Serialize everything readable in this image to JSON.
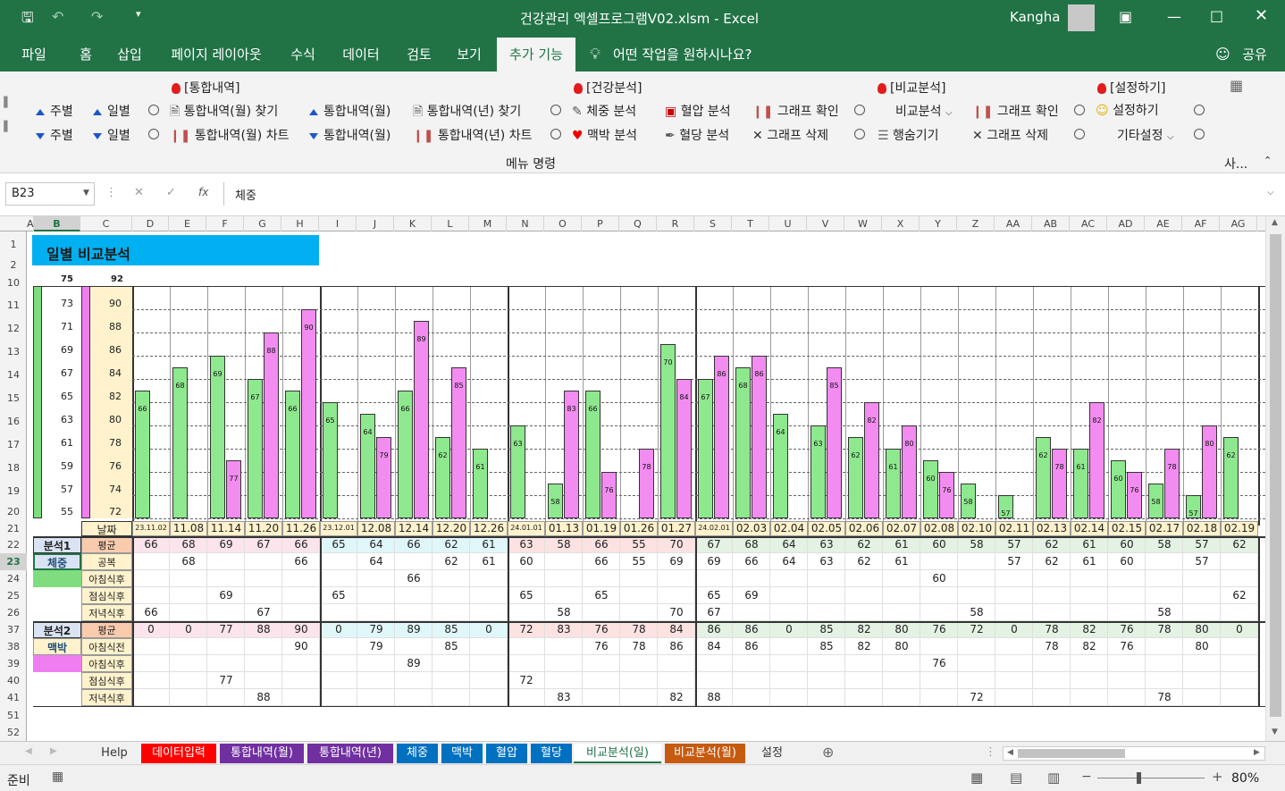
{
  "window": {
    "title": "건강관리 엑셀프로그램V02.xlsm  -  Excel",
    "user": "Kangha"
  },
  "tabs": [
    "파일",
    "홈",
    "삽입",
    "페이지 레이아웃",
    "수식",
    "데이터",
    "검토",
    "보기",
    "추가 기능"
  ],
  "tell_me": "어떤 작업을 원하시나요?",
  "share": "공유",
  "ribbon": {
    "group_headers": [
      "[통합내역]",
      "[건강분석]",
      "[비교분석]",
      "[설정하기]"
    ],
    "row1": [
      "주별",
      "일별",
      "통합내역(월) 찾기",
      "통합내역(월)",
      "통합내역(년) 찾기",
      "체중 분석",
      "혈압 분석",
      "그래프 확인",
      "비교분석",
      "그래프 확인",
      "설정하기"
    ],
    "row2": [
      "주별",
      "일별",
      "통합내역(월) 차트",
      "통합내역(월)",
      "통합내역(년) 차트",
      "맥박 분석",
      "혈당 분석",
      "그래프 삭제",
      "행숨기기",
      "그래프 삭제",
      "기타설정"
    ],
    "group_label": "메뉴 명령",
    "cut_label": "사..."
  },
  "formula_bar": {
    "name_box": "B23",
    "content": "체중",
    "fx": "fx"
  },
  "col_headers": [
    "A",
    "B",
    "C",
    "D",
    "E",
    "F",
    "G",
    "H",
    "I",
    "J",
    "K",
    "L",
    "M",
    "N",
    "O",
    "P",
    "Q",
    "R",
    "S",
    "T",
    "U",
    "V",
    "W",
    "X",
    "Y",
    "Z",
    "AA",
    "AB",
    "AC",
    "AD",
    "AE",
    "AF",
    "AG"
  ],
  "row_headers": [
    "1",
    "2",
    "10",
    "11",
    "12",
    "13",
    "14",
    "15",
    "16",
    "17",
    "18",
    "19",
    "20",
    "21",
    "22",
    "23",
    "24",
    "25",
    "26",
    "37",
    "38",
    "39",
    "40",
    "41",
    "51",
    "52"
  ],
  "sheet": {
    "title": "일별 비교분석",
    "scale_left_top": "75",
    "scale_right_top": "92",
    "scale_left": [
      "73",
      "71",
      "69",
      "67",
      "65",
      "63",
      "61",
      "59",
      "57",
      "55"
    ],
    "scale_right": [
      "90",
      "88",
      "86",
      "84",
      "82",
      "80",
      "78",
      "76",
      "74",
      "72"
    ],
    "date_header": "날짜",
    "dates": [
      "23.11.02",
      "11.08",
      "11.14",
      "11.20",
      "11.26",
      "23.12.01",
      "12.08",
      "12.14",
      "12.20",
      "12.26",
      "24.01.01",
      "01.13",
      "01.19",
      "01.26",
      "01.27",
      "24.02.01",
      "02.03",
      "02.04",
      "02.05",
      "02.06",
      "02.07",
      "02.08",
      "02.10",
      "02.11",
      "02.13",
      "02.14",
      "02.15",
      "02.17",
      "02.18",
      "02.19"
    ],
    "analysis1_label": "분석1",
    "analysis1_item": "체중",
    "analysis2_label": "분석2",
    "analysis2_item": "맥박",
    "row_labels1": [
      "평균",
      "공복",
      "아침식후",
      "점심식후",
      "저녁식후"
    ],
    "row_labels2": [
      "평균",
      "아침식전",
      "아침식후",
      "점심식후",
      "저녁식후"
    ],
    "a1_rows": [
      [
        "66",
        "68",
        "69",
        "67",
        "66",
        "65",
        "64",
        "66",
        "62",
        "61",
        "63",
        "58",
        "66",
        "55",
        "70",
        "67",
        "68",
        "64",
        "63",
        "62",
        "61",
        "60",
        "58",
        "57",
        "62",
        "61",
        "60",
        "58",
        "57",
        "62"
      ],
      [
        "",
        "68",
        "",
        "",
        "66",
        "",
        "64",
        "",
        "62",
        "61",
        "60",
        "",
        "66",
        "55",
        "69",
        "69",
        "66",
        "64",
        "63",
        "62",
        "61",
        "",
        "",
        "57",
        "62",
        "61",
        "60",
        "",
        "57",
        ""
      ],
      [
        "",
        "",
        "",
        "",
        "",
        "",
        "",
        "66",
        "",
        "",
        "",
        "",
        "",
        "",
        "",
        "",
        "",
        "",
        "",
        "",
        "",
        "60",
        "",
        "",
        "",
        "",
        "",
        "",
        "",
        ""
      ],
      [
        "",
        "",
        "69",
        "",
        "",
        "65",
        "",
        "",
        "",
        "",
        "65",
        "",
        "65",
        "",
        "",
        "65",
        "69",
        "",
        "",
        "",
        "",
        "",
        "",
        "",
        "",
        "",
        "",
        "",
        "",
        "62"
      ],
      [
        "66",
        "",
        "",
        "67",
        "",
        "",
        "",
        "",
        "",
        "",
        "",
        "58",
        "",
        "",
        "70",
        "67",
        "",
        "",
        "",
        "",
        "",
        "",
        "58",
        "",
        "",
        "",
        "",
        "58",
        "",
        ""
      ]
    ],
    "a2_rows": [
      [
        "0",
        "0",
        "77",
        "88",
        "90",
        "0",
        "79",
        "89",
        "85",
        "0",
        "72",
        "83",
        "76",
        "78",
        "84",
        "86",
        "86",
        "0",
        "85",
        "82",
        "80",
        "76",
        "72",
        "0",
        "78",
        "82",
        "76",
        "78",
        "80",
        "0"
      ],
      [
        "",
        "",
        "",
        "",
        "90",
        "",
        "79",
        "",
        "85",
        "",
        "",
        "",
        "76",
        "78",
        "86",
        "84",
        "86",
        "",
        "85",
        "82",
        "80",
        "",
        "",
        "",
        "78",
        "82",
        "76",
        "",
        "80",
        ""
      ],
      [
        "",
        "",
        "",
        "",
        "",
        "",
        "",
        "89",
        "",
        "",
        "",
        "",
        "",
        "",
        "",
        "",
        "",
        "",
        "",
        "",
        "",
        "76",
        "",
        "",
        "",
        "",
        "",
        "",
        "",
        ""
      ],
      [
        "",
        "",
        "77",
        "",
        "",
        "",
        "",
        "",
        "",
        "",
        "72",
        "",
        "",
        "",
        "",
        "",
        "",
        "",
        "",
        "",
        "",
        "",
        "",
        "",
        "",
        "",
        "",
        "",
        "",
        ""
      ],
      [
        "",
        "",
        "",
        "88",
        "",
        "",
        "",
        "",
        "",
        "",
        "",
        "83",
        "",
        "",
        "82",
        "88",
        "",
        "",
        "",
        "",
        "",
        "",
        "72",
        "",
        "",
        "",
        "",
        "78",
        "",
        ""
      ]
    ]
  },
  "chart_data": {
    "type": "bar",
    "categories": [
      "23.11.02",
      "11.08",
      "11.14",
      "11.20",
      "11.26",
      "23.12.01",
      "12.08",
      "12.14",
      "12.20",
      "12.26",
      "24.01.01",
      "01.13",
      "01.19",
      "01.26",
      "01.27",
      "24.02.01",
      "02.03",
      "02.04",
      "02.05",
      "02.06",
      "02.07",
      "02.08",
      "02.10",
      "02.11",
      "02.13",
      "02.14",
      "02.15",
      "02.17",
      "02.18",
      "02.19"
    ],
    "series": [
      {
        "name": "체중",
        "color": "#8ee88e",
        "axis": "left",
        "values": [
          66,
          68,
          69,
          67,
          66,
          65,
          64,
          66,
          62,
          61,
          63,
          58,
          66,
          null,
          70,
          67,
          68,
          64,
          63,
          62,
          61,
          60,
          58,
          57,
          62,
          61,
          60,
          58,
          57,
          62
        ]
      },
      {
        "name": "맥박",
        "color": "#f28cf0",
        "axis": "right",
        "values": [
          null,
          null,
          77,
          88,
          90,
          null,
          79,
          89,
          85,
          null,
          null,
          83,
          76,
          78,
          84,
          86,
          86,
          null,
          85,
          82,
          80,
          76,
          null,
          null,
          78,
          82,
          76,
          78,
          80,
          null
        ]
      }
    ],
    "ylim_left": [
      55,
      75
    ],
    "ylim_right": [
      72,
      92
    ]
  },
  "sheet_tabs": [
    {
      "label": "Help",
      "bg": "#f0f0f0",
      "fg": "#333"
    },
    {
      "label": "데이터입력",
      "bg": "#ff0000",
      "fg": "#fff"
    },
    {
      "label": "통합내역(월)",
      "bg": "#7030a0",
      "fg": "#fff"
    },
    {
      "label": "통합내역(년)",
      "bg": "#7030a0",
      "fg": "#fff"
    },
    {
      "label": "체중",
      "bg": "#0070c0",
      "fg": "#fff"
    },
    {
      "label": "맥박",
      "bg": "#0070c0",
      "fg": "#fff"
    },
    {
      "label": "혈압",
      "bg": "#0070c0",
      "fg": "#fff"
    },
    {
      "label": "혈당",
      "bg": "#0070c0",
      "fg": "#fff"
    },
    {
      "label": "비교분석(일)",
      "bg": "#ffffff",
      "fg": "#217346"
    },
    {
      "label": "비교분석(월)",
      "bg": "#c55a11",
      "fg": "#fff"
    },
    {
      "label": "설정",
      "bg": "#f0f0f0",
      "fg": "#333"
    }
  ],
  "status": {
    "ready": "준비",
    "zoom": "80%"
  }
}
